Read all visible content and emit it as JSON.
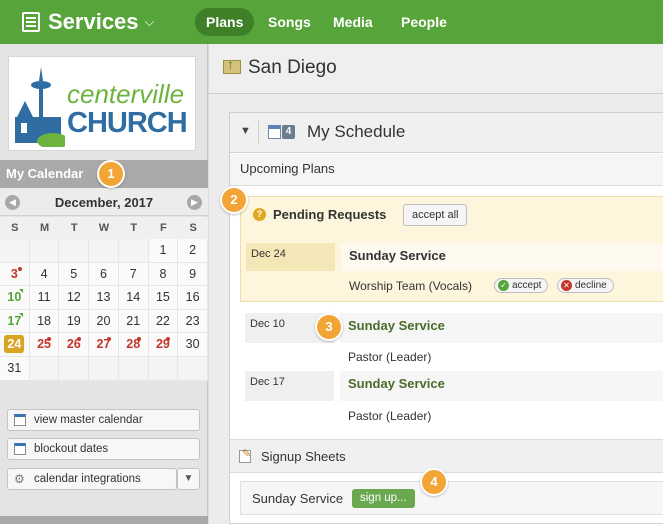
{
  "app": {
    "title": "Services",
    "dropdown_glyph": "⌵",
    "nav": [
      "Plans",
      "Songs",
      "Media",
      "People"
    ],
    "active_nav": "Plans",
    "accent": "#57a43a"
  },
  "sidebar": {
    "logo": {
      "line1": "centerville",
      "line2": "CHURCH"
    },
    "calendar": {
      "header": "My Calendar",
      "month": "December, 2017",
      "prev_glyph": "◀",
      "next_glyph": "▶",
      "dows": [
        "S",
        "M",
        "T",
        "W",
        "T",
        "F",
        "S"
      ],
      "weeks": [
        [
          "",
          "",
          "",
          "",
          "",
          "1",
          "2"
        ],
        [
          "3",
          "4",
          "5",
          "6",
          "7",
          "8",
          "9"
        ],
        [
          "10",
          "11",
          "12",
          "13",
          "14",
          "15",
          "16"
        ],
        [
          "17",
          "18",
          "19",
          "20",
          "21",
          "22",
          "23"
        ],
        [
          "24",
          "25",
          "26",
          "27",
          "28",
          "29",
          "30"
        ],
        [
          "31",
          "",
          "",
          "",
          "",
          "",
          ""
        ]
      ]
    },
    "buttons": {
      "master": "view master calendar",
      "blockout": "blockout dates",
      "integrations": "calendar integrations",
      "dropdown_glyph": "▼"
    }
  },
  "main": {
    "location": "San Diego",
    "schedule": {
      "toggle_glyph": "▼",
      "badge": "4",
      "title": "My Schedule",
      "upcoming_label": "Upcoming Plans",
      "pending": {
        "icon_glyph": "?",
        "title": "Pending Requests",
        "accept_all": "accept all",
        "date": "Dec 24",
        "name": "Sunday Service",
        "role": "Worship Team (Vocals)",
        "accept": "accept",
        "decline": "decline"
      },
      "plans": [
        {
          "date": "Dec 10",
          "name": "Sunday Service",
          "role": "Pastor (Leader)"
        },
        {
          "date": "Dec 17",
          "name": "Sunday Service",
          "role": "Pastor (Leader)"
        }
      ]
    },
    "signup": {
      "title": "Signup Sheets",
      "row_name": "Sunday Service",
      "button": "sign up..."
    }
  },
  "callouts": [
    "1",
    "2",
    "3",
    "4"
  ]
}
